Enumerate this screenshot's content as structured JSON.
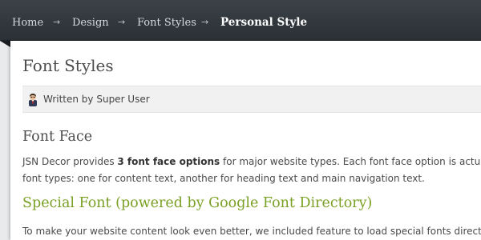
{
  "breadcrumb": {
    "items": [
      "Home",
      "Design",
      "Font Styles"
    ],
    "separator": "→",
    "current": "Personal Style"
  },
  "article": {
    "title": "Font Styles",
    "author_line": "Written by Super User",
    "section_heading": "Font Face",
    "paragraph1": {
      "prefix": "JSN Decor provides ",
      "bold": "3 font face options",
      "suffix_line1": " for major website types. Each font face option is actually",
      "line2": "font types: one for content text, another for heading text and main navigation text."
    },
    "special_heading": "Special Font (powered by Google Font Directory)",
    "paragraph2": "To make your website content look even better, we included feature to load special fonts directly"
  },
  "colors": {
    "breadcrumb_bg": "#343a40",
    "accent_green": "#7aa025",
    "text": "#4a4a4a"
  },
  "icons": {
    "author": "user-avatar-icon"
  }
}
